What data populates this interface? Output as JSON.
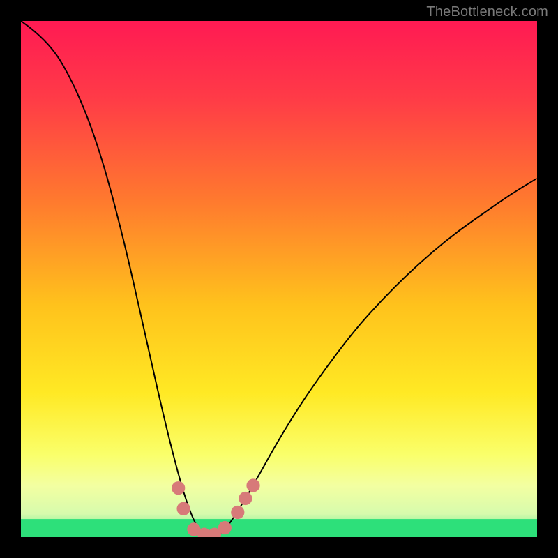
{
  "watermark": {
    "text": "TheBottleneck.com"
  },
  "chart_data": {
    "type": "line",
    "title": "",
    "xlabel": "",
    "ylabel": "",
    "x_range": [
      0,
      1
    ],
    "y_range": [
      0,
      1
    ],
    "curve": {
      "description": "V-shaped bottleneck curve; high at both x extremes, dips to near-zero around x≈0.35",
      "points": [
        [
          0.0,
          1.0
        ],
        [
          0.05,
          0.965
        ],
        [
          0.1,
          0.885
        ],
        [
          0.15,
          0.76
        ],
        [
          0.2,
          0.575
        ],
        [
          0.25,
          0.35
        ],
        [
          0.28,
          0.22
        ],
        [
          0.3,
          0.14
        ],
        [
          0.32,
          0.07
        ],
        [
          0.34,
          0.02
        ],
        [
          0.36,
          0.0
        ],
        [
          0.38,
          0.0
        ],
        [
          0.4,
          0.02
        ],
        [
          0.42,
          0.05
        ],
        [
          0.45,
          0.1
        ],
        [
          0.5,
          0.19
        ],
        [
          0.55,
          0.27
        ],
        [
          0.6,
          0.34
        ],
        [
          0.65,
          0.405
        ],
        [
          0.7,
          0.46
        ],
        [
          0.75,
          0.51
        ],
        [
          0.8,
          0.555
        ],
        [
          0.85,
          0.595
        ],
        [
          0.9,
          0.63
        ],
        [
          0.95,
          0.665
        ],
        [
          1.0,
          0.695
        ]
      ]
    },
    "threshold_band": {
      "y_min": 0.0,
      "y_max": 0.035,
      "color": "#2de07a"
    },
    "upper_band": {
      "y_min": 0.035,
      "y_max": 0.16,
      "color_top": "#fafec2",
      "color_bottom": "#e9fcb4"
    },
    "markers": {
      "color": "#d77a79",
      "radius_norm": 0.013,
      "points": [
        [
          0.305,
          0.095
        ],
        [
          0.315,
          0.055
        ],
        [
          0.335,
          0.015
        ],
        [
          0.355,
          0.005
        ],
        [
          0.375,
          0.005
        ],
        [
          0.395,
          0.018
        ],
        [
          0.42,
          0.048
        ],
        [
          0.435,
          0.075
        ],
        [
          0.45,
          0.1
        ]
      ]
    },
    "background_gradient": {
      "stops": [
        [
          0.0,
          "#ff1a53"
        ],
        [
          0.15,
          "#ff3b47"
        ],
        [
          0.35,
          "#ff7a2e"
        ],
        [
          0.55,
          "#ffc21c"
        ],
        [
          0.72,
          "#ffe924"
        ],
        [
          0.84,
          "#faff6a"
        ],
        [
          0.9,
          "#f3ffa1"
        ],
        [
          0.955,
          "#d7fbad"
        ],
        [
          0.975,
          "#9af29c"
        ],
        [
          1.0,
          "#2de07a"
        ]
      ]
    }
  }
}
